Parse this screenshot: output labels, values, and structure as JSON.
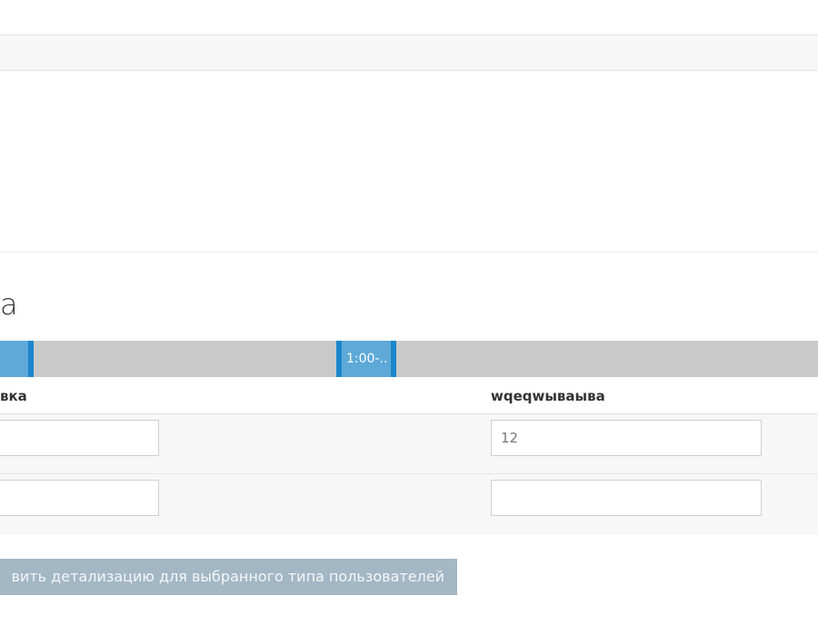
{
  "section": {
    "heading": "а"
  },
  "timeline": {
    "segments": [
      {
        "label": ""
      },
      {
        "label": "1:00-.."
      }
    ]
  },
  "detail_table": {
    "columns": [
      "вка",
      "wqeqwываыва"
    ],
    "rows": [
      {
        "left_value": "",
        "right_value": "12"
      },
      {
        "left_value": "",
        "right_value": ""
      }
    ]
  },
  "actions": {
    "save_label": "вить детализацию для выбранного типа пользователей"
  },
  "colors": {
    "accent_blue": "#1b86cc",
    "segment_fill": "#5ea9d8",
    "timeline_track": "#c9c9c9",
    "button_disabled": "#a3b7c5"
  }
}
